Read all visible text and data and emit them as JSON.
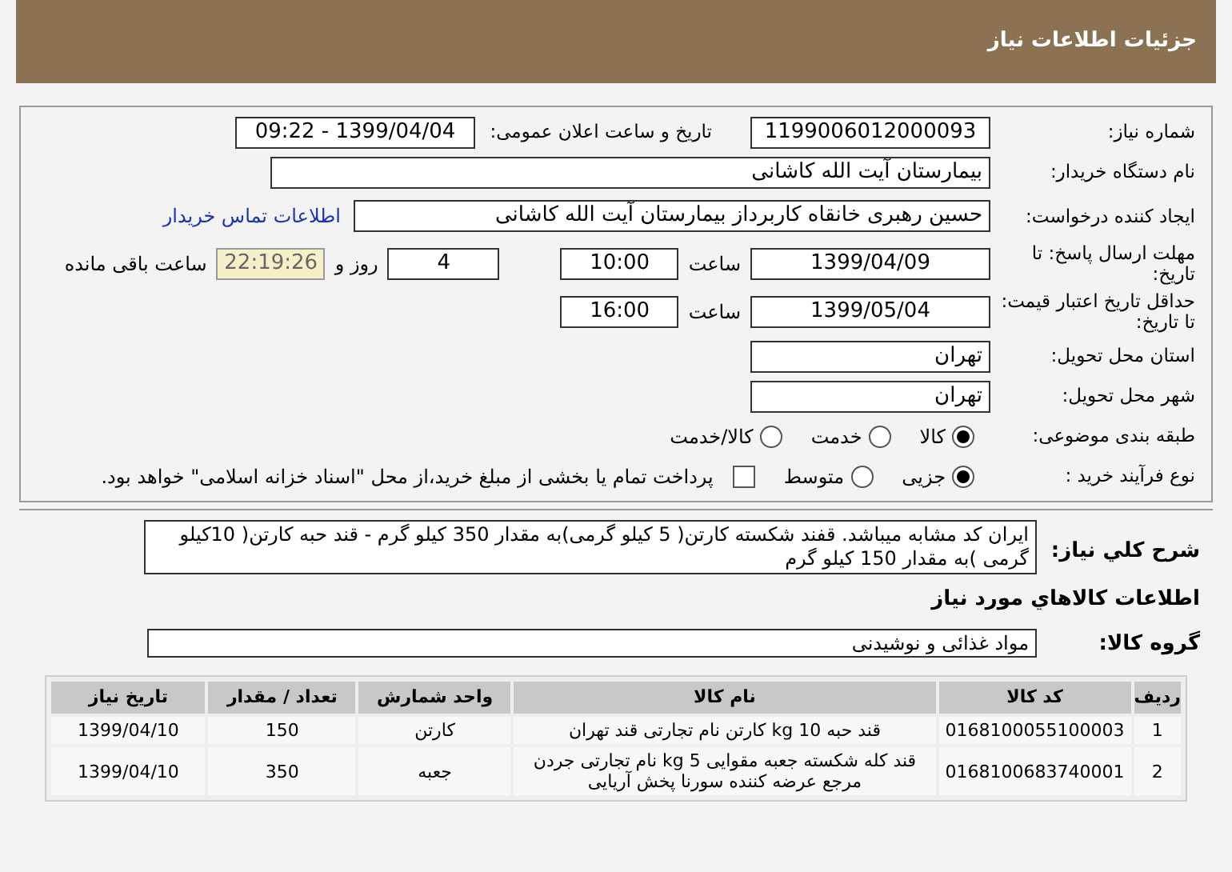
{
  "header": {
    "title": "جزئیات اطلاعات نیاز"
  },
  "fields": {
    "need_number_label": "شماره نیاز:",
    "need_number": "1199006012000093",
    "announce_label": "تاریخ و ساعت اعلان عمومی:",
    "announce": "1399/04/04 - 09:22",
    "buyer_label": "نام دستگاه خریدار:",
    "buyer": "بیمارستان آیت الله کاشانی",
    "creator_label": "ایجاد کننده درخواست:",
    "creator": "حسین رهبری خانقاه کاربرداز بیمارستان آیت الله کاشانی",
    "contact_link": "اطلاعات تماس خریدار",
    "reply_label": "مهلت ارسال پاسخ: تا تاریخ:",
    "reply_date": "1399/04/09",
    "reply_time_label": "ساعت",
    "reply_time": "10:00",
    "days": "4",
    "days_label": "روز و",
    "remaining": "22:19:26",
    "remaining_label": "ساعت باقی مانده",
    "validity_label": "حداقل تاریخ اعتبار قیمت: تا تاریخ:",
    "validity_date": "1399/05/04",
    "validity_time_label": "ساعت",
    "validity_time": "16:00",
    "province_label": "استان محل تحویل:",
    "province": "تهران",
    "city_label": "شهر محل تحویل:",
    "city": "تهران"
  },
  "category": {
    "label": "طبقه بندی موضوعی:",
    "options": [
      {
        "label": "کالا",
        "selected": true
      },
      {
        "label": "خدمت",
        "selected": false
      },
      {
        "label": "کالا/خدمت",
        "selected": false
      }
    ]
  },
  "process": {
    "label": "نوع فرآیند خرید :",
    "options": [
      {
        "label": "جزیی",
        "selected": true
      },
      {
        "label": "متوسط",
        "selected": false
      }
    ],
    "treasury": {
      "label": "پرداخت تمام یا بخشی از مبلغ خرید،از محل \"اسناد خزانه اسلامی\" خواهد بود.",
      "checked": false
    }
  },
  "description": {
    "label": "شرح کلي نياز:",
    "text": "ایران کد مشابه میباشد. قفند شکسته کارتن( 5 کیلو گرمی)به مقدار 350 کیلو گرم - قند حبه کارتن( 10کیلو گرمی )به مقدار 150 کیلو گرم"
  },
  "goods_title": "اطلاعات کالاهاي مورد نياز",
  "group": {
    "label": "گروه کالا:",
    "value": "مواد غذائی و نوشیدنی"
  },
  "table": {
    "columns": [
      "ردیف",
      "کد کالا",
      "نام کالا",
      "واحد شمارش",
      "تعداد / مقدار",
      "تاریخ نیاز"
    ],
    "rows": [
      [
        "1",
        "0168100055100003",
        "قند حبه 10 kg کارتن نام تجارتی قند تهران",
        "کارتن",
        "150",
        "1399/04/10"
      ],
      [
        "2",
        "0168100683740001",
        "قند کله شکسته جعبه مقوایی 5 kg نام تجارتی جردن مرجع عرضه کننده سورنا پخش آریایی",
        "جعبه",
        "350",
        "1399/04/10"
      ]
    ]
  }
}
